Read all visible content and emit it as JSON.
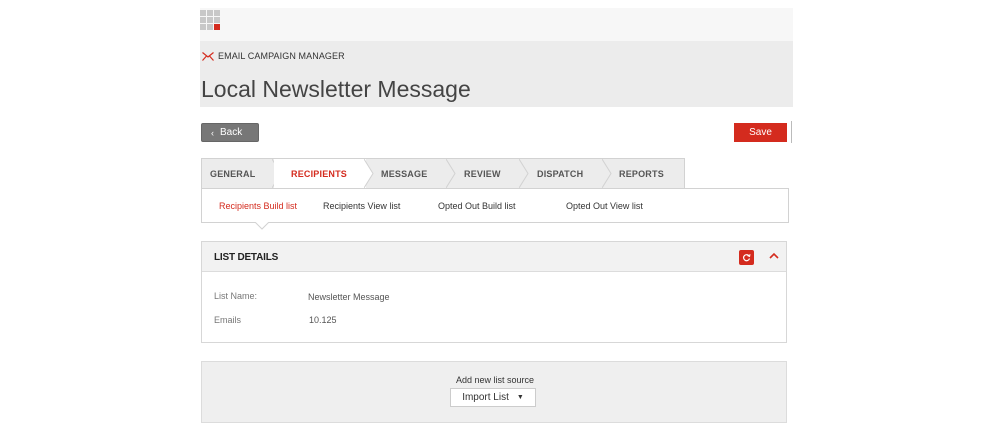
{
  "app": {
    "name": "EMAIL CAMPAIGN MANAGER",
    "page_title": "Local Newsletter Message"
  },
  "toolbar": {
    "back_label": "Back",
    "save_label": "Save"
  },
  "tabs": [
    {
      "label": "GENERAL",
      "active": false
    },
    {
      "label": "RECIPIENTS",
      "active": true
    },
    {
      "label": "MESSAGE",
      "active": false
    },
    {
      "label": "REVIEW",
      "active": false
    },
    {
      "label": "DISPATCH",
      "active": false
    },
    {
      "label": "REPORTS",
      "active": false
    }
  ],
  "subnav": [
    {
      "label": "Recipients Build list",
      "active": true
    },
    {
      "label": "Recipients View list",
      "active": false
    },
    {
      "label": "Opted Out Build list",
      "active": false
    },
    {
      "label": "Opted Out View list",
      "active": false
    }
  ],
  "list_details": {
    "title": "LIST DETAILS",
    "rows": [
      {
        "label": "List Name:",
        "value": "Newsletter Message"
      },
      {
        "label": "Emails",
        "value": "10.125"
      }
    ]
  },
  "list_source": {
    "label": "Add new list source",
    "button": "Import List"
  },
  "colors": {
    "accent": "#d42b1e",
    "header_bg": "#ececec"
  }
}
